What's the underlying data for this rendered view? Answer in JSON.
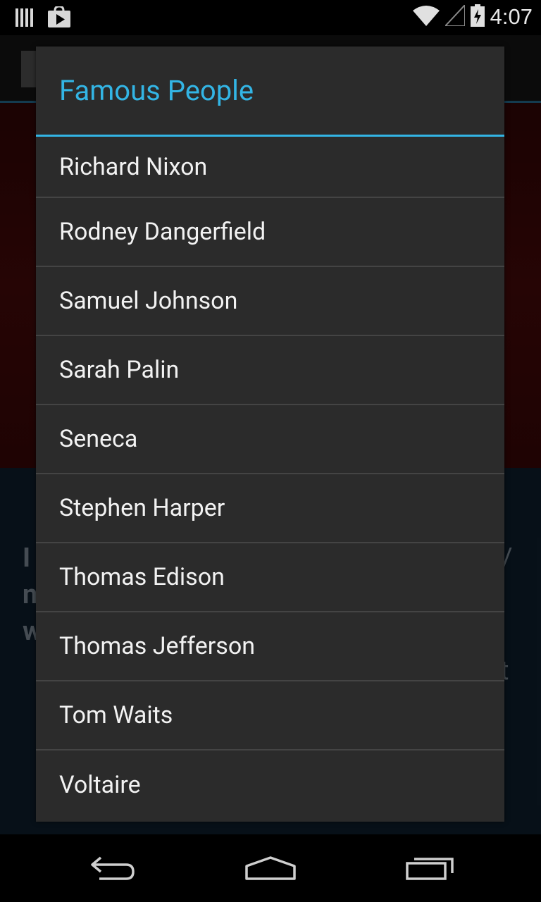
{
  "status_bar": {
    "time": "4:07",
    "icons": [
      "storage-icon",
      "play-store-icon",
      "wifi-icon",
      "signal-icon",
      "battery-charging-icon"
    ]
  },
  "background": {
    "partial_text": [
      "I",
      "n",
      "w",
      "/",
      "t"
    ]
  },
  "dialog": {
    "title": "Famous People",
    "items": [
      "Richard Nixon",
      "Rodney Dangerfield",
      "Samuel Johnson",
      "Sarah Palin",
      "Seneca",
      "Stephen Harper",
      "Thomas Edison",
      "Thomas Jefferson",
      "Tom Waits",
      "Voltaire"
    ]
  },
  "colors": {
    "accent": "#33b5e5",
    "dialog_bg": "#2b2b2b",
    "divider": "#444444"
  },
  "nav": {
    "buttons": [
      "back-icon",
      "home-icon",
      "recent-apps-icon"
    ]
  }
}
